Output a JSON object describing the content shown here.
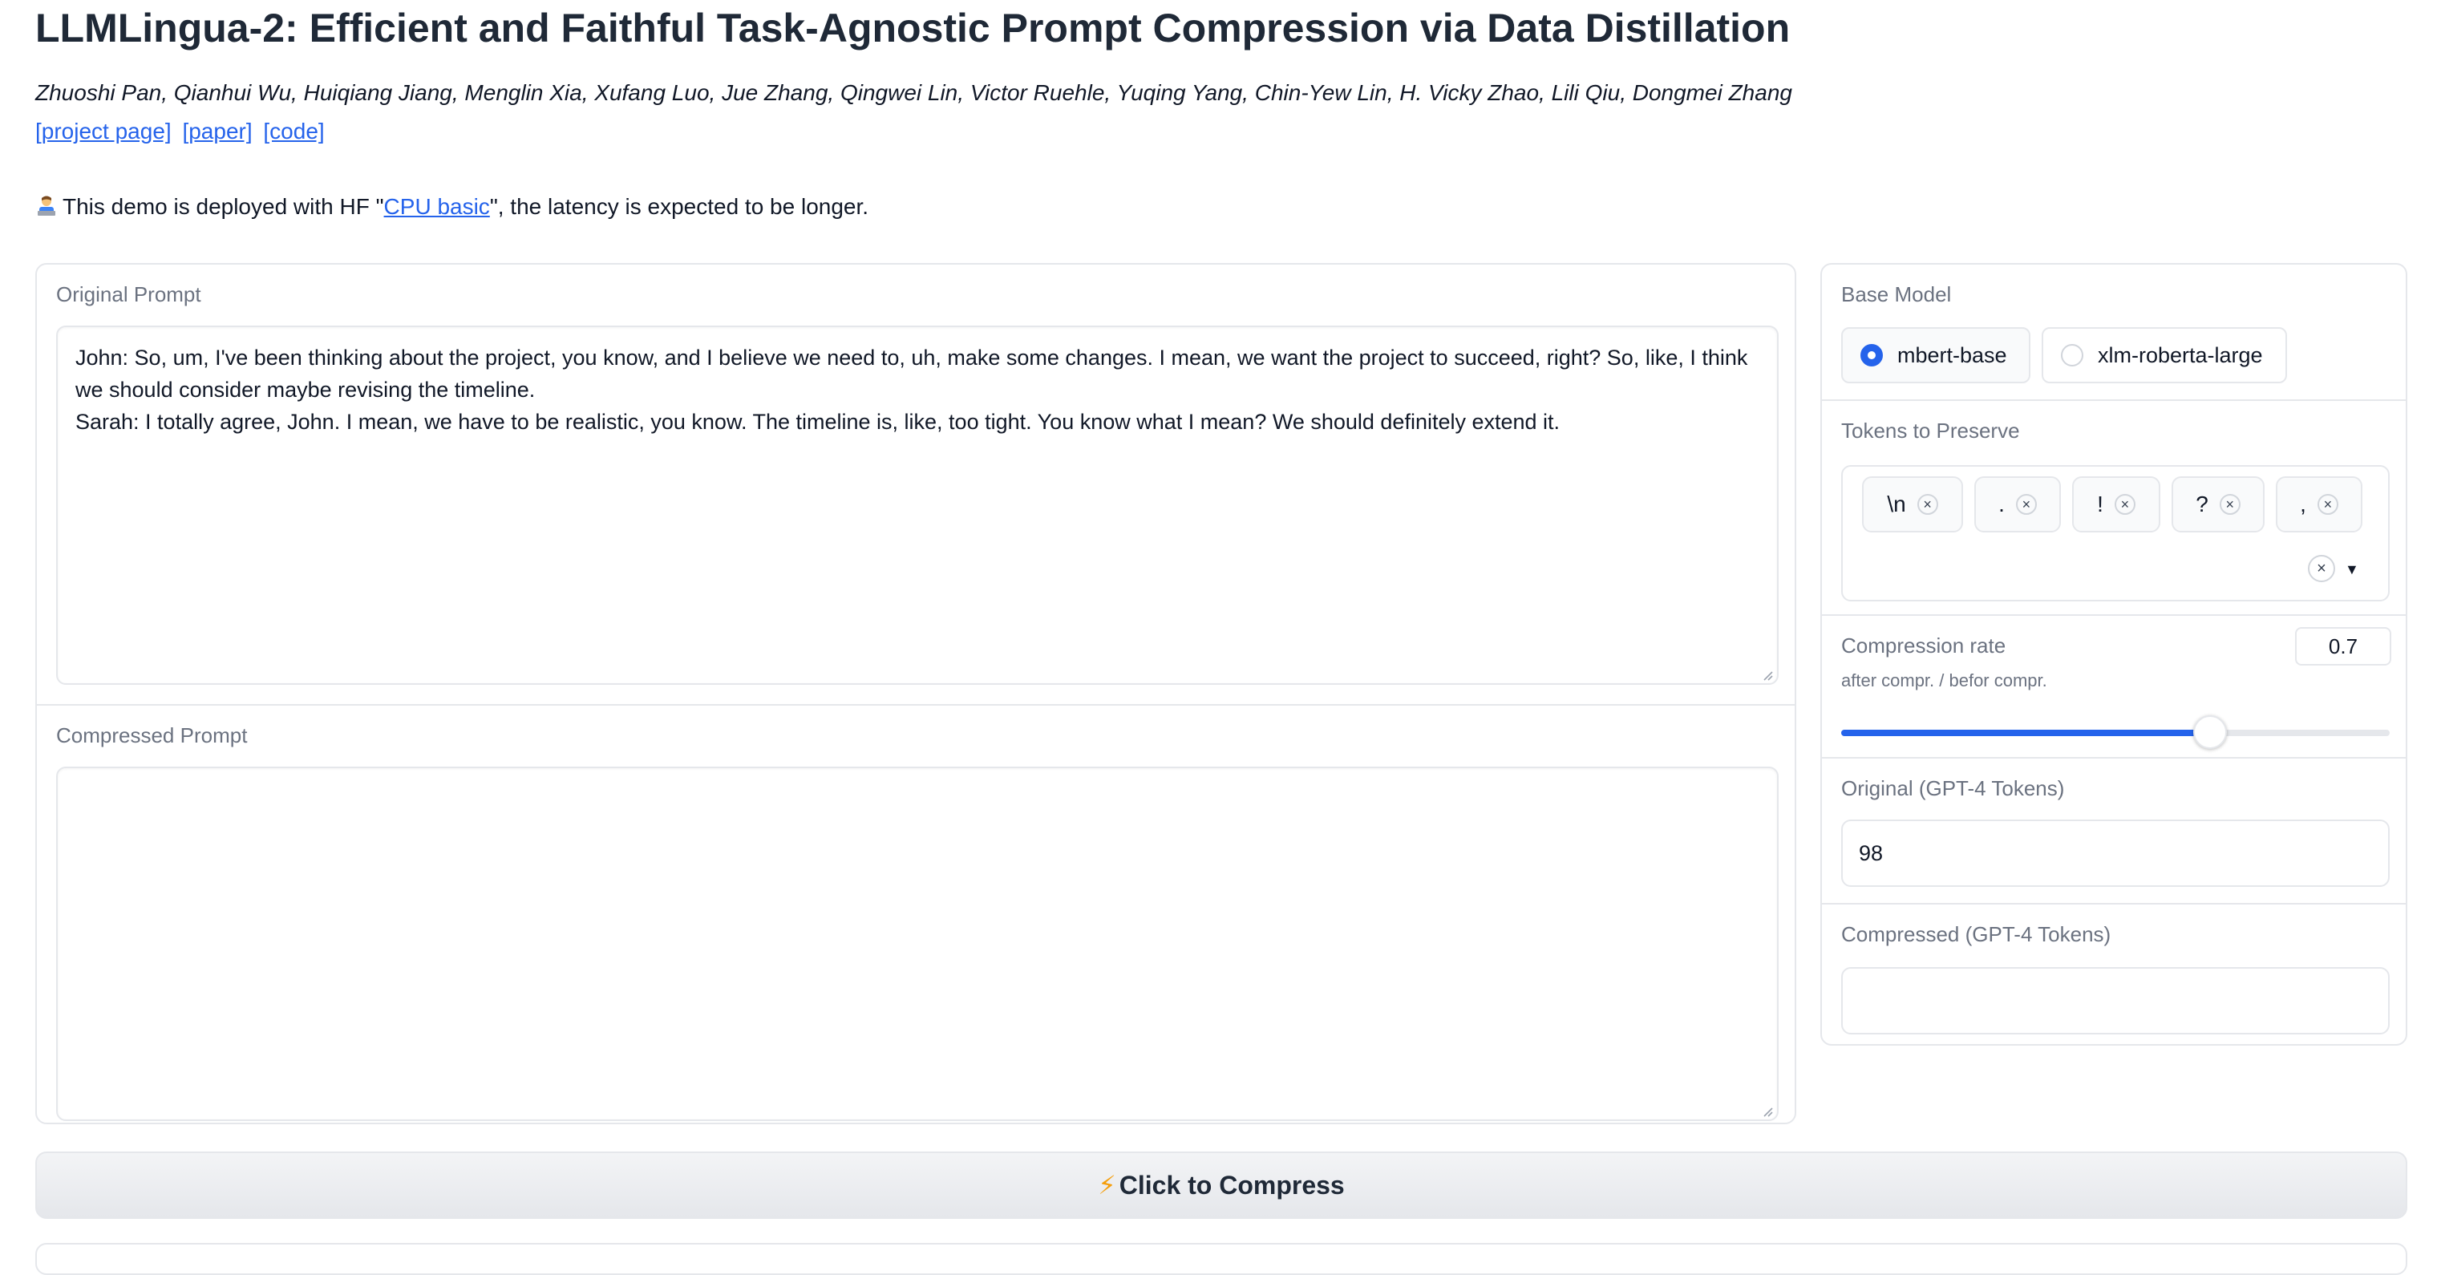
{
  "header": {
    "title": "LLMLingua-2: Efficient and Faithful Task-Agnostic Prompt Compression via Data Distillation",
    "authors": "Zhuoshi Pan, Qianhui Wu, Huiqiang Jiang, Menglin Xia, Xufang Luo, Jue Zhang, Qingwei Lin, Victor Ruehle, Yuqing Yang, Chin-Yew Lin, H. Vicky Zhao, Lili Qiu, Dongmei Zhang",
    "links": [
      "[project page]",
      "[paper]",
      "[code]"
    ]
  },
  "notice": {
    "before": "This demo is deployed with HF \"",
    "link": "CPU basic",
    "after": "\", the latency is expected to be longer.",
    "icon": "technologist-emoji-icon"
  },
  "original_prompt": {
    "label": "Original Prompt",
    "value": "John: So, um, I've been thinking about the project, you know, and I believe we need to, uh, make some changes. I mean, we want the project to succeed, right? So, like, I think we should consider maybe revising the timeline.\nSarah: I totally agree, John. I mean, we have to be realistic, you know. The timeline is, like, too tight. You know what I mean? We should definitely extend it."
  },
  "compressed_prompt": {
    "label": "Compressed Prompt",
    "value": ""
  },
  "base_model": {
    "label": "Base Model",
    "options": [
      "mbert-base",
      "xlm-roberta-large"
    ],
    "selected": "mbert-base"
  },
  "tokens_to_preserve": {
    "label": "Tokens to Preserve",
    "chips": [
      "\\n",
      ".",
      "!",
      "?",
      ","
    ],
    "remove_icon": "close-icon",
    "clear_icon": "clear-all-icon",
    "caret_icon": "caret-down-icon"
  },
  "compression_rate": {
    "label": "Compression rate",
    "sublabel": "after compr. / befor compr.",
    "value": "0.7",
    "slider_fraction": 0.7
  },
  "original_tokens": {
    "label": "Original (GPT-4 Tokens)",
    "value": "98"
  },
  "compressed_tokens": {
    "label": "Compressed (GPT-4 Tokens)",
    "value": ""
  },
  "compress_button": {
    "icon": "⚡",
    "label": "Click to Compress"
  },
  "colors": {
    "accent": "#2563eb",
    "border": "#e5e7eb",
    "label": "#6b7280"
  }
}
